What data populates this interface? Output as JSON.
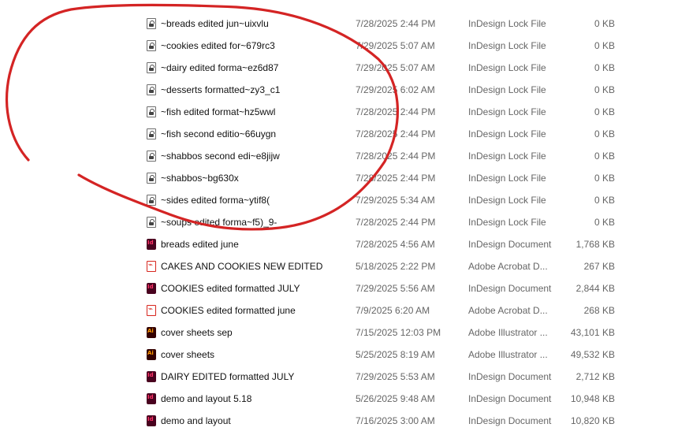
{
  "annotation": {
    "color": "#d42424",
    "description": "hand-drawn red circle around lock files"
  },
  "files": [
    {
      "name": "~breads  edited jun~uixvlu",
      "modified": "7/28/2025 2:44 PM",
      "type": "InDesign Lock File",
      "size": "0 KB",
      "icon": "lock-file-icon"
    },
    {
      "name": "~cookies edited for~679rc3",
      "modified": "7/29/2025 5:07 AM",
      "type": "InDesign Lock File",
      "size": "0 KB",
      "icon": "lock-file-icon"
    },
    {
      "name": "~dairy edited forma~ez6d87",
      "modified": "7/29/2025 5:07 AM",
      "type": "InDesign Lock File",
      "size": "0 KB",
      "icon": "lock-file-icon"
    },
    {
      "name": "~desserts formatted~zy3_c1",
      "modified": "7/29/2025 6:02 AM",
      "type": "InDesign Lock File",
      "size": "0 KB",
      "icon": "lock-file-icon"
    },
    {
      "name": "~fish edited format~hz5wwl",
      "modified": "7/28/2025 2:44 PM",
      "type": "InDesign Lock File",
      "size": "0 KB",
      "icon": "lock-file-icon"
    },
    {
      "name": "~fish second editio~66uygn",
      "modified": "7/28/2025 2:44 PM",
      "type": "InDesign Lock File",
      "size": "0 KB",
      "icon": "lock-file-icon"
    },
    {
      "name": "~shabbos second edi~e8jijw",
      "modified": "7/28/2025 2:44 PM",
      "type": "InDesign Lock File",
      "size": "0 KB",
      "icon": "lock-file-icon"
    },
    {
      "name": "~shabbos~bg630x",
      "modified": "7/28/2025 2:44 PM",
      "type": "InDesign Lock File",
      "size": "0 KB",
      "icon": "lock-file-icon"
    },
    {
      "name": "~sides edited forma~ytif8(",
      "modified": "7/29/2025 5:34 AM",
      "type": "InDesign Lock File",
      "size": "0 KB",
      "icon": "lock-file-icon"
    },
    {
      "name": "~soups edited forma~f5)_9-",
      "modified": "7/28/2025 2:44 PM",
      "type": "InDesign Lock File",
      "size": "0 KB",
      "icon": "lock-file-icon"
    },
    {
      "name": "breads  edited june",
      "modified": "7/28/2025 4:56 AM",
      "type": "InDesign Document",
      "size": "1,768 KB",
      "icon": "indesign-file-icon"
    },
    {
      "name": "CAKES AND COOKIES NEW EDITED",
      "modified": "5/18/2025 2:22 PM",
      "type": "Adobe Acrobat D...",
      "size": "267 KB",
      "icon": "pdf-file-icon"
    },
    {
      "name": "COOKIES edited formatted JULY",
      "modified": "7/29/2025 5:56 AM",
      "type": "InDesign Document",
      "size": "2,844 KB",
      "icon": "indesign-file-icon"
    },
    {
      "name": "COOKIES edited formatted june",
      "modified": "7/9/2025 6:20 AM",
      "type": "Adobe Acrobat D...",
      "size": "268 KB",
      "icon": "pdf-file-icon"
    },
    {
      "name": "cover sheets sep",
      "modified": "7/15/2025 12:03 PM",
      "type": "Adobe Illustrator ...",
      "size": "43,101 KB",
      "icon": "illustrator-file-icon"
    },
    {
      "name": "cover sheets",
      "modified": "5/25/2025 8:19 AM",
      "type": "Adobe Illustrator ...",
      "size": "49,532 KB",
      "icon": "illustrator-file-icon"
    },
    {
      "name": "DAIRY EDITED formatted JULY",
      "modified": "7/29/2025 5:53 AM",
      "type": "InDesign Document",
      "size": "2,712 KB",
      "icon": "indesign-file-icon"
    },
    {
      "name": "demo and layout 5.18",
      "modified": "5/26/2025 9:48 AM",
      "type": "InDesign Document",
      "size": "10,948 KB",
      "icon": "indesign-file-icon"
    },
    {
      "name": "demo and layout",
      "modified": "7/16/2025 3:00 AM",
      "type": "InDesign Document",
      "size": "10,820 KB",
      "icon": "indesign-file-icon"
    }
  ]
}
